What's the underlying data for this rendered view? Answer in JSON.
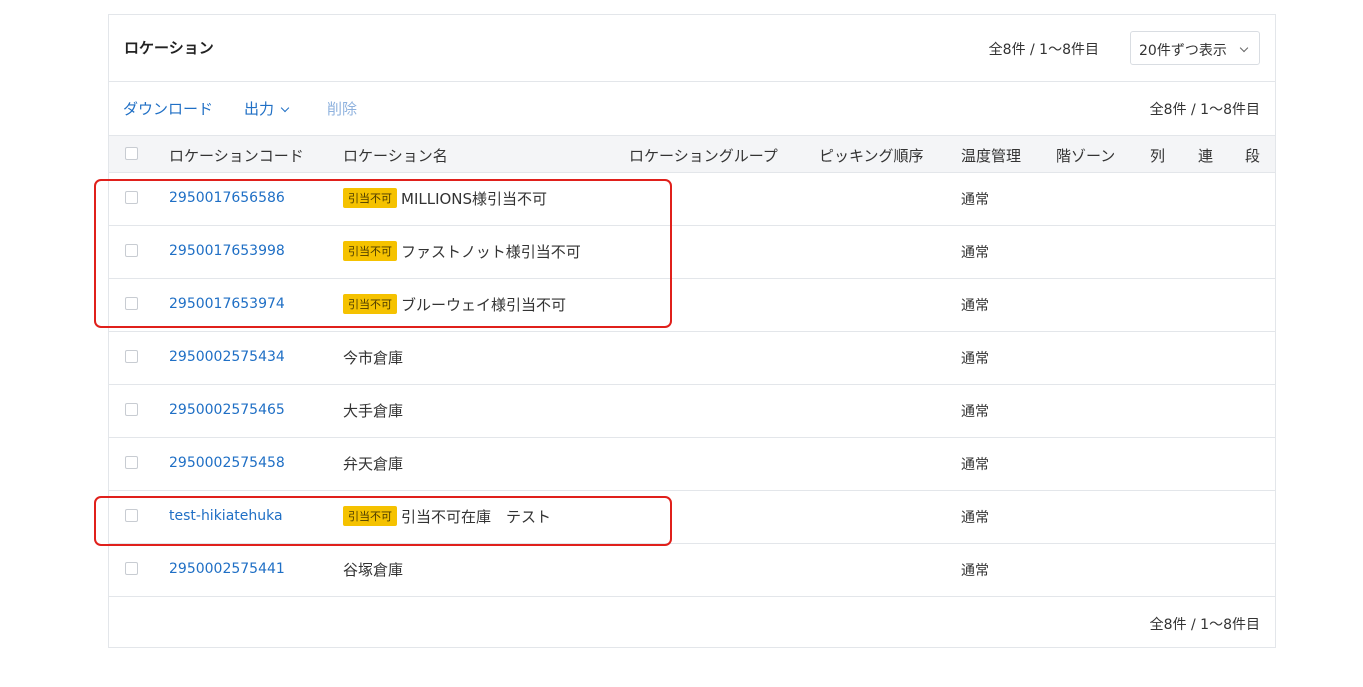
{
  "panel": {
    "title": "ロケーション",
    "count_text": "全8件 / 1〜8件目",
    "per_page": "20件ずつ表示"
  },
  "toolbar": {
    "download": "ダウンロード",
    "output": "出力",
    "delete": "削除",
    "count_text": "全8件 / 1〜8件目"
  },
  "table": {
    "headers": {
      "code": "ロケーションコード",
      "name": "ロケーション名",
      "group": "ロケーショングループ",
      "picking_order": "ピッキング順序",
      "temperature": "温度管理",
      "floor_zone": "階ゾーン",
      "column": "列",
      "bay": "連",
      "level": "段"
    },
    "rows": [
      {
        "code": "2950017656586",
        "badge": "引当不可",
        "name": "MILLIONS様引当不可",
        "temperature": "通常"
      },
      {
        "code": "2950017653998",
        "badge": "引当不可",
        "name": "ファストノット様引当不可",
        "temperature": "通常"
      },
      {
        "code": "2950017653974",
        "badge": "引当不可",
        "name": "ブルーウェイ様引当不可",
        "temperature": "通常"
      },
      {
        "code": "2950002575434",
        "badge": "",
        "name": "今市倉庫",
        "temperature": "通常"
      },
      {
        "code": "2950002575465",
        "badge": "",
        "name": "大手倉庫",
        "temperature": "通常"
      },
      {
        "code": "2950002575458",
        "badge": "",
        "name": "弁天倉庫",
        "temperature": "通常"
      },
      {
        "code": "test-hikiatehuka",
        "badge": "引当不可",
        "name": "引当不可在庫　テスト",
        "temperature": "通常"
      },
      {
        "code": "2950002575441",
        "badge": "",
        "name": "谷塚倉庫",
        "temperature": "通常"
      }
    ]
  },
  "footer": {
    "count_text": "全8件 / 1〜8件目"
  },
  "colors": {
    "link": "#1f6fc5",
    "badge": "#f5c200",
    "highlight": "#e0201b"
  }
}
